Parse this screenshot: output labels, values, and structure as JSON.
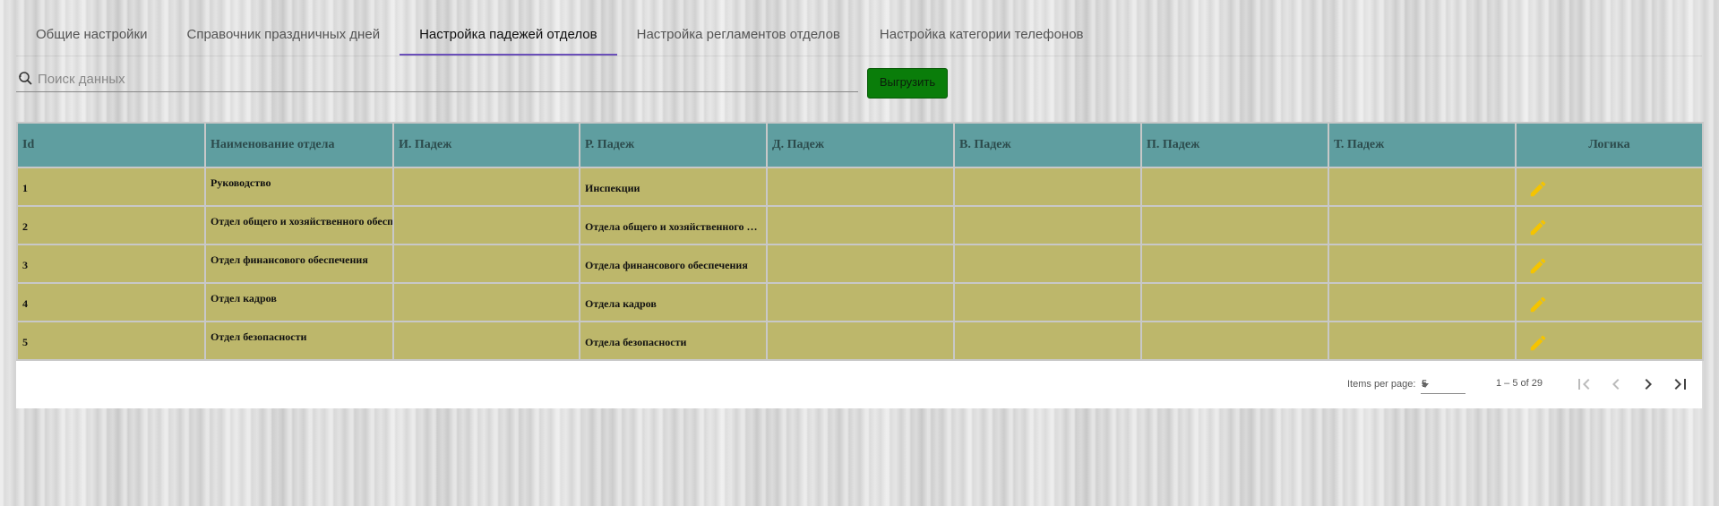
{
  "tabs": [
    {
      "label": "Общие настройки"
    },
    {
      "label": "Справочник праздничных дней"
    },
    {
      "label": "Настройка падежей отделов",
      "active": true
    },
    {
      "label": "Настройка регламентов отделов"
    },
    {
      "label": "Настройка категории телефонов"
    }
  ],
  "search": {
    "placeholder": "Поиск данных",
    "value": "",
    "icon": "search-icon"
  },
  "export_button": {
    "label": "Выгрузить",
    "color": "#0a7d0a"
  },
  "table": {
    "header_color": "#5f9ea0",
    "row_color": "#bdb76b",
    "columns": [
      "Id",
      "Наименование отдела",
      "И. Падеж",
      "Р. Падеж",
      "Д. Падеж",
      "В. Падеж",
      "П. Падеж",
      "Т. Падеж",
      "Логика"
    ],
    "rows": [
      {
        "id": "1",
        "name": "Руководство",
        "nom": "",
        "gen": "Инспекции",
        "dat": "",
        "acc": "",
        "prep": "",
        "instr": "",
        "action_icon": "pencil-icon"
      },
      {
        "id": "2",
        "name": "Отдел общего и хозяйственного обеспечения",
        "nom": "",
        "gen": "Отдела общего и хозяйственного обеспечения",
        "dat": "",
        "acc": "",
        "prep": "",
        "instr": "",
        "action_icon": "pencil-icon"
      },
      {
        "id": "3",
        "name": "Отдел финансового обеспечения",
        "nom": "",
        "gen": "Отдела финансового обеспечения",
        "dat": "",
        "acc": "",
        "prep": "",
        "instr": "",
        "action_icon": "pencil-icon"
      },
      {
        "id": "4",
        "name": "Отдел кадров",
        "nom": "",
        "gen": "Отдела кадров",
        "dat": "",
        "acc": "",
        "prep": "",
        "instr": "",
        "action_icon": "pencil-icon"
      },
      {
        "id": "5",
        "name": "Отдел безопасности",
        "nom": "",
        "gen": "Отдела безопасности",
        "dat": "",
        "acc": "",
        "prep": "",
        "instr": "",
        "action_icon": "pencil-icon"
      }
    ]
  },
  "paginator": {
    "items_per_page_label": "Items per page:",
    "items_per_page": "5",
    "range_label": "1 – 5 of 29",
    "icons": [
      "first-page-icon",
      "previous-page-icon",
      "next-page-icon",
      "last-page-icon"
    ]
  },
  "colors": {
    "active_tab_underline": "#6a4fb8",
    "edit_icon": "#f5c400"
  }
}
